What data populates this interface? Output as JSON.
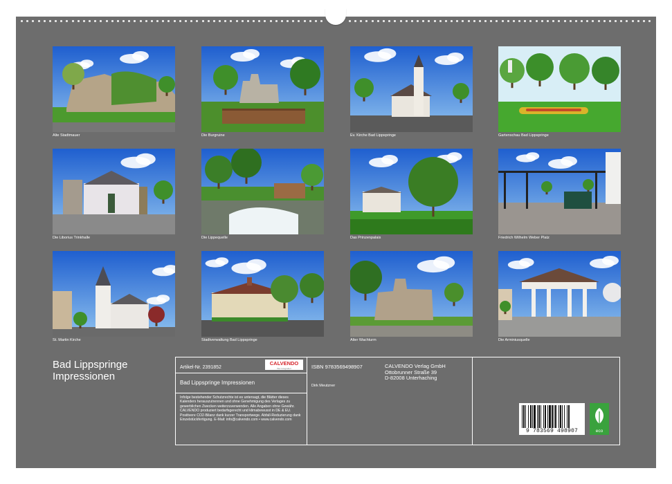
{
  "calendar": {
    "title_line1": "Bad Lippspringe",
    "title_line2": "Impressionen"
  },
  "tiles": [
    {
      "caption": "Alte Stadtmauer",
      "scene": "wall"
    },
    {
      "caption": "Die Burgruine",
      "scene": "ruin"
    },
    {
      "caption": "Ev. Kirche Bad Lippspringe",
      "scene": "church"
    },
    {
      "caption": "Gartenschau Bad Lippspringe",
      "scene": "garden"
    },
    {
      "caption": "Die Liborius Trinkhalle",
      "scene": "hall"
    },
    {
      "caption": "Die Lippequelle",
      "scene": "spring"
    },
    {
      "caption": "Das Prinzenpalais",
      "scene": "palais"
    },
    {
      "caption": "Friedrich Wilhelm Weber Platz",
      "scene": "plaza"
    },
    {
      "caption": "St. Martin Kirche",
      "scene": "martin"
    },
    {
      "caption": "Stadtverwaltung Bad Lippspringe",
      "scene": "townhall"
    },
    {
      "caption": "Alter Wachturm",
      "scene": "tower"
    },
    {
      "caption": "Die Arminiusquelle",
      "scene": "pavilion"
    }
  ],
  "info": {
    "article_label": "Artikel-Nr. 2391852",
    "logo_text": "CALVENDO",
    "logo_sub": "Wer fotografiert",
    "book_title": "Bad Lippspringe Impressionen",
    "isbn": "ISBN 9783569498907",
    "publisher_line1": "CALVENDO Verlag GmbH",
    "publisher_line2": "Ottobrunner Straße 39",
    "publisher_line3": "D-82008 Unterhaching",
    "author": "Dirk Meutzner",
    "legal": "Infolge bestehender Schutzrechte ist es untersagt, die Blätter dieses Kalenders herauszutrennen und ohne Genehmigung des Verlages zu gewerblichen Zwecken weiterzuverwenden. Alle Angaben ohne Gewähr. CALVENDO produziert bedarfsgerecht und klimabewusst in DE & EU. Positivere CO2-Bilanz dank kurzer Transportwege. Abfall-Reduzierung dank Einzelstückfertigung. E-Mail: info@calvendo.com • www.calvendo.com",
    "barcode_digits": "9 783569 498907",
    "eco_label": "eco"
  },
  "colors": {
    "sheet": "#6d6d6d",
    "sky": "#2f6fd6",
    "grass": "#3f9a2a",
    "eco": "#3aa23d",
    "brand": "#d6252b"
  }
}
